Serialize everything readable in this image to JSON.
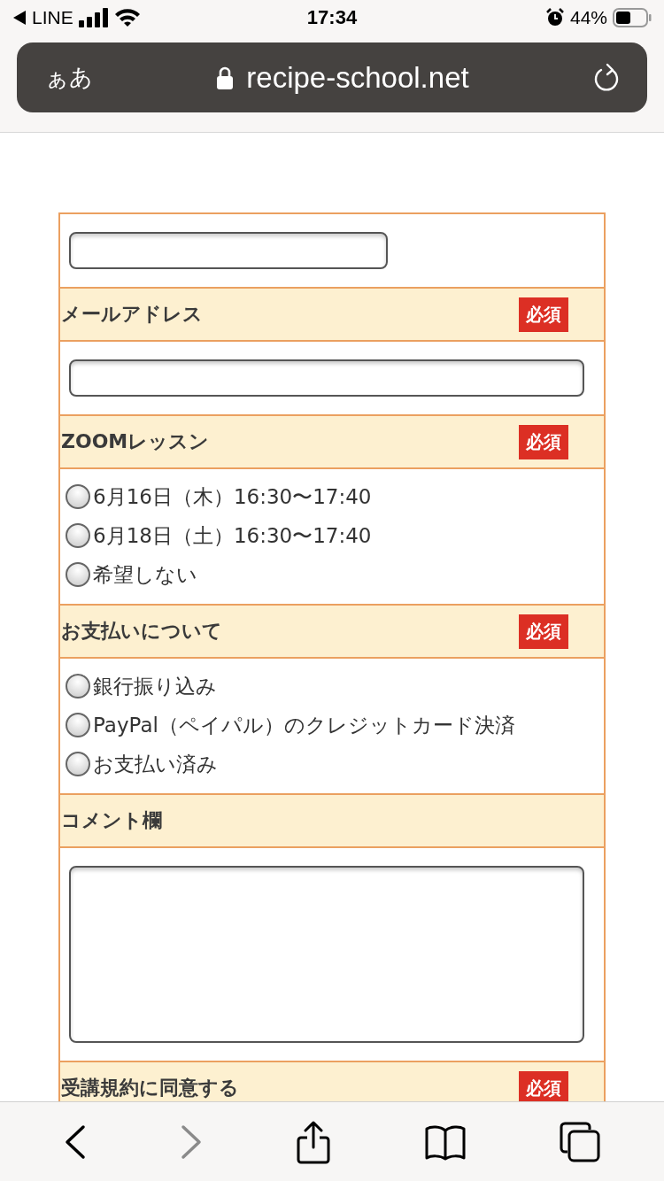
{
  "status_bar": {
    "back_label": "LINE",
    "time": "17:34",
    "battery": "44%"
  },
  "address_bar": {
    "text_size": "ぁあ",
    "url": "recipe-school.net"
  },
  "form": {
    "rows": [
      {
        "kind": "short_input"
      },
      {
        "kind": "header",
        "label": "メールアドレス",
        "badge": "必須"
      },
      {
        "kind": "input"
      },
      {
        "kind": "header",
        "label": "ZOOMレッスン",
        "badge": "必須"
      },
      {
        "kind": "radios",
        "options": [
          {
            "label": "6月16日（木）16:30〜17:40",
            "selected": false
          },
          {
            "label": "6月18日（土）16:30〜17:40",
            "selected": false
          },
          {
            "label": "希望しない",
            "selected": false
          }
        ]
      },
      {
        "kind": "header",
        "label": "お支払いについて",
        "badge": "必須"
      },
      {
        "kind": "radios",
        "options": [
          {
            "label": "銀行振り込み",
            "selected": false
          },
          {
            "label": "PayPal（ペイパル）のクレジットカード決済",
            "selected": false
          },
          {
            "label": "お支払い済み",
            "selected": false
          }
        ]
      },
      {
        "kind": "header",
        "label": "コメント欄"
      },
      {
        "kind": "textarea"
      },
      {
        "kind": "header",
        "label": "受講規約に同意する",
        "badge": "必須"
      }
    ]
  }
}
